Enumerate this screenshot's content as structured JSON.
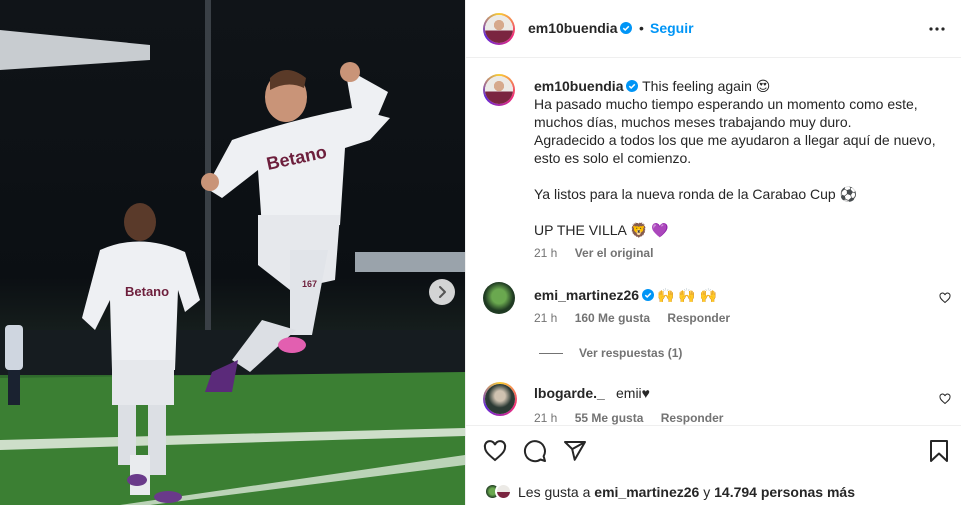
{
  "post": {
    "author": "em10buendia",
    "follow_label": "Seguir",
    "separator": "•",
    "caption_author": "em10buendia",
    "caption_lines": [
      "This feeling again 😍",
      "Ha pasado mucho tiempo esperando un momento como este,",
      "muchos días, muchos meses trabajando muy duro.",
      "Agradecido a todos los que me ayudaron a llegar aquí de nuevo,",
      "esto es solo el comienzo.",
      "",
      "Ya listos para la nueva ronda de la Carabao Cup ⚽",
      "",
      "UP THE VILLA 🦁 💜"
    ],
    "time": "21 h",
    "see_translation": "Ver el original"
  },
  "comments": [
    {
      "user": "emi_martinez26",
      "text": "🙌 🙌 🙌",
      "time": "21 h",
      "likes": "160 Me gusta",
      "reply": "Responder",
      "verified": true
    },
    {
      "user": "lbogarde._",
      "text": "emii♥",
      "time": "21 h",
      "likes": "55 Me gusta",
      "reply": "Responder",
      "verified": false
    }
  ],
  "view_replies": "Ver respuestas (1)",
  "likes_summary": {
    "prefix": "Les gusta a ",
    "user": "emi_martinez26",
    "middle": " y ",
    "count": "14.794 personas más"
  },
  "photo": {
    "sponsor_1": "Betano",
    "sponsor_2": "Betano",
    "shirt_number": "167"
  },
  "colors": {
    "accent": "#0095f6",
    "verified": "#0095f6",
    "text": "#262626",
    "muted": "#737373"
  },
  "icons": {
    "verified": "verified-badge-icon",
    "more": "more-options-icon",
    "heart": "heart-icon",
    "comment": "comment-icon",
    "share": "share-icon",
    "save": "bookmark-icon",
    "next": "chevron-right-icon"
  }
}
